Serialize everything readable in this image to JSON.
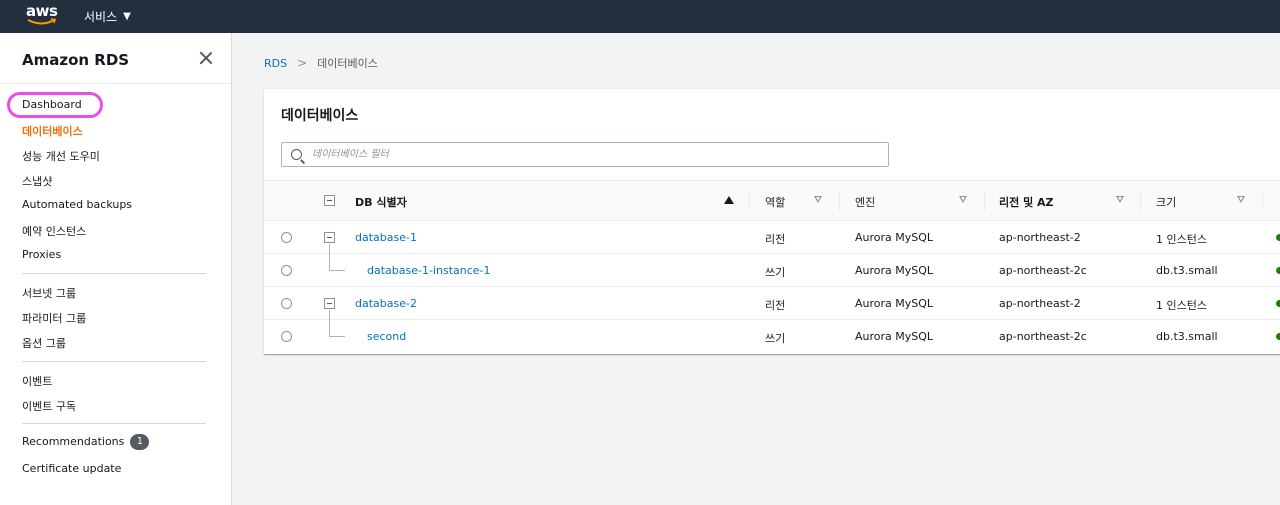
{
  "topnav": {
    "logo_text": "aws",
    "services_label": "서비스"
  },
  "sidebar": {
    "title": "Amazon RDS",
    "groups": [
      [
        "Dashboard",
        "데이터베이스",
        "성능 개선 도우미",
        "스냅샷",
        "Automated backups",
        "예약 인스턴스",
        "Proxies"
      ],
      [
        "서브넷 그룹",
        "파라미터 그룹",
        "옵션 그룹"
      ],
      [
        "이벤트",
        "이벤트 구독"
      ],
      [
        "Recommendations",
        "Certificate update"
      ]
    ],
    "recommendations_badge": "1",
    "active_item": "데이터베이스"
  },
  "breadcrumb": {
    "root": "RDS",
    "current": "데이터베이스"
  },
  "panel": {
    "title": "데이터베이스",
    "search_placeholder": "데이터베이스 필터"
  },
  "table": {
    "columns": [
      "DB 식별자",
      "역할",
      "엔진",
      "리전 및 AZ",
      "크기"
    ],
    "rows": [
      {
        "id": "database-1",
        "role": "리전",
        "engine": "Aurora MySQL",
        "region": "ap-northeast-2",
        "size": "1 인스턴스",
        "level": 0
      },
      {
        "id": "database-1-instance-1",
        "role": "쓰기",
        "engine": "Aurora MySQL",
        "region": "ap-northeast-2c",
        "size": "db.t3.small",
        "level": 1
      },
      {
        "id": "database-2",
        "role": "리전",
        "engine": "Aurora MySQL",
        "region": "ap-northeast-2",
        "size": "1 인스턴스",
        "level": 0
      },
      {
        "id": "second",
        "role": "쓰기",
        "engine": "Aurora MySQL",
        "region": "ap-northeast-2c",
        "size": "db.t3.small",
        "level": 1
      }
    ]
  },
  "colors": {
    "nav_bg": "#232f3e",
    "active": "#ec7211",
    "link": "#0073bb",
    "highlight": "#e84fe7",
    "status_ok": "#1d8102"
  }
}
